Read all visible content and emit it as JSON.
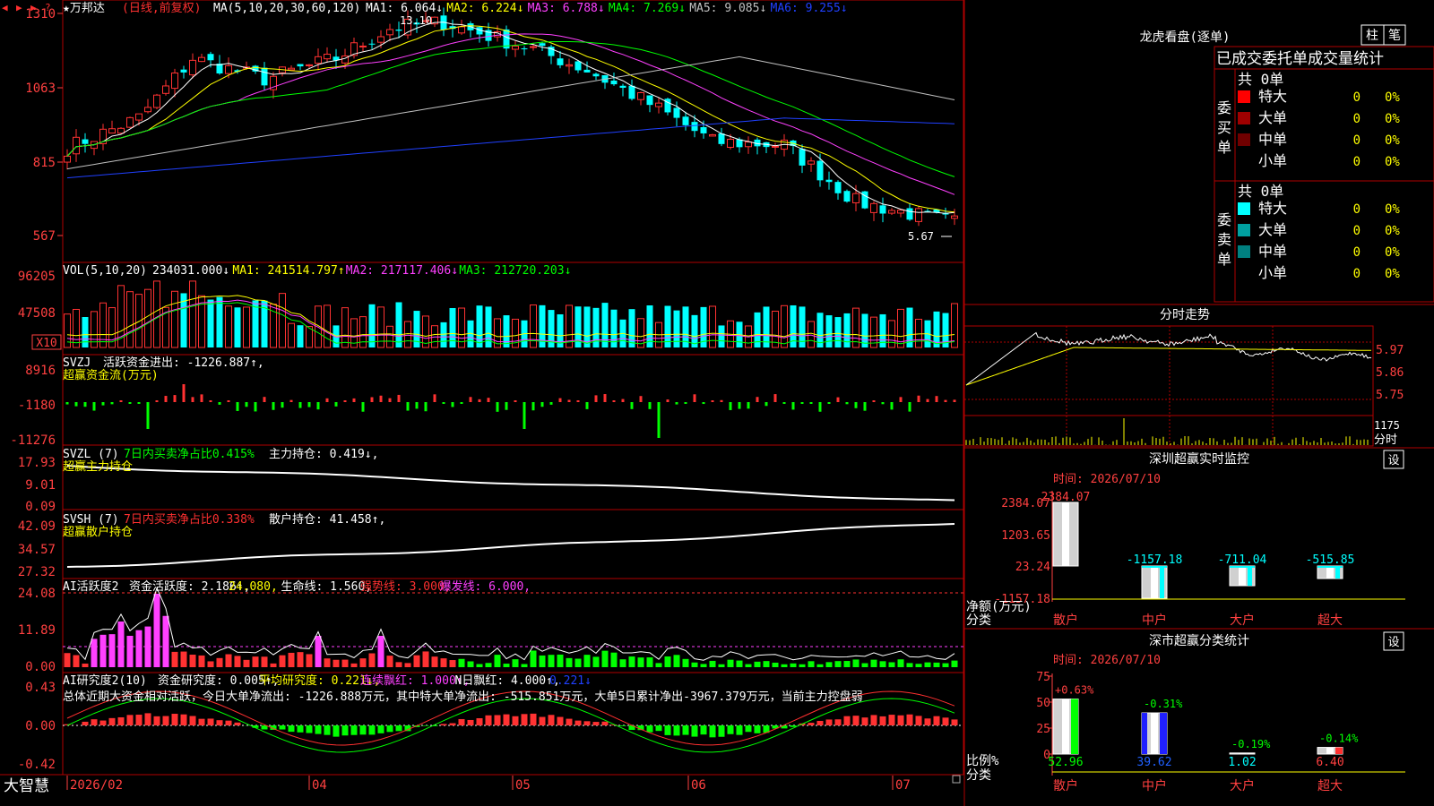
{
  "app": {
    "name": "大智慧"
  },
  "stock": {
    "title": "★万邦达",
    "mode": "(日线,前复权)",
    "title_color": "#ffffff",
    "mode_color": "#ff3030"
  },
  "top_icons": {
    "prev": "◀",
    "next": "▶",
    "refresh": "▶",
    "more": "?"
  },
  "price_axis": [
    "1310",
    "1063",
    "815",
    "567"
  ],
  "ma_header": {
    "label": "MA(5,10,20,30,60,120)",
    "items": [
      {
        "text": "MA1: 6.064↓",
        "color": "#ffffff"
      },
      {
        "text": "MA2: 6.224↓",
        "color": "#ffff00"
      },
      {
        "text": "MA3: 6.788↓",
        "color": "#ff40ff"
      },
      {
        "text": "MA4: 7.269↓",
        "color": "#00ff00"
      },
      {
        "text": "MA5: 9.085↓",
        "color": "#c0c0c0"
      },
      {
        "text": "MA6: 9.255↓",
        "color": "#2040ff"
      }
    ]
  },
  "price_marks": {
    "high": "13.10",
    "low": "5.67"
  },
  "vol_header": {
    "label": "VOL(5,10,20)",
    "items": [
      {
        "text": "234031.000↓",
        "color": "#ffffff"
      },
      {
        "text": "MA1: 241514.797↑",
        "color": "#ffff00"
      },
      {
        "text": "MA2: 217117.406↓",
        "color": "#ff40ff"
      },
      {
        "text": "MA3: 212720.203↓",
        "color": "#00ff00"
      }
    ]
  },
  "vol_axis": [
    "96205",
    "47508"
  ],
  "vol_unit": "X10",
  "svzj": {
    "label": "SVZJ",
    "active_text": "活跃资金进出: -1226.887↑,",
    "sub": "超赢资金流(万元)",
    "axis": [
      "8916",
      "-1180",
      "-11276"
    ]
  },
  "svzl": {
    "label": "SVZL (7)",
    "ratio_text": "7日内买卖净占比0.415%",
    "hold_text": "主力持仓: 0.419↓,",
    "sub": "超赢主力持仓",
    "axis": [
      "17.93",
      "9.01",
      "0.09"
    ]
  },
  "svsh": {
    "label": "SVSH (7)",
    "ratio_text": "7日内买卖净占比0.338%",
    "hold_text": "散户持仓: 41.458↑,",
    "sub": "超赢散户持仓",
    "axis": [
      "42.09",
      "34.57",
      "27.32"
    ]
  },
  "ai_active": {
    "label": "AI活跃度2",
    "items": [
      {
        "text": "资金活跃度: 2.186↑,",
        "color": "#ffffff"
      },
      {
        "text": "24.080,",
        "color": "#ffff00"
      },
      {
        "text": "生命线: 1.560,",
        "color": "#ffffff"
      },
      {
        "text": "强势线: 3.000,",
        "color": "#ff3030"
      },
      {
        "text": "爆发线: 6.000,",
        "color": "#ff40ff"
      }
    ],
    "axis": [
      "24.08",
      "11.89",
      "0.00"
    ]
  },
  "ai_research": {
    "label": "AI研究度2(10)",
    "items": [
      {
        "text": "资金研究度: 0.005↑,",
        "color": "#ffffff"
      },
      {
        "text": "平均研究度: 0.221↓,",
        "color": "#ffff00"
      },
      {
        "text": "连续飘红: 1.000↑,",
        "color": "#ff40ff"
      },
      {
        "text": "N日飘红: 4.000↑,",
        "color": "#ffffff"
      },
      {
        "text": "0.221↓",
        "color": "#2040ff"
      }
    ],
    "summary": "总体近期大资金相对活跃，今日大单净流出: -1226.888万元，其中特大单净流出: -515.851万元，大单5日累计净出-3967.379万元，当前主力控盘弱",
    "axis": [
      "0.43",
      "0.00",
      "-0.42"
    ]
  },
  "x_axis": {
    "labels": [
      "2026/02",
      "04",
      "05",
      "06",
      "07"
    ]
  },
  "dragon": {
    "title": "龙虎看盘(逐单)",
    "tab1": "柱",
    "tab2": "笔",
    "tabs_text": "已成交委托单成交量统计",
    "buy": {
      "side": [
        "委",
        "买",
        "单"
      ],
      "total": "共 0单",
      "rows": [
        {
          "name": "特大",
          "count": "0",
          "pct": "0%",
          "color": "#ff0000"
        },
        {
          "name": "大单",
          "count": "0",
          "pct": "0%",
          "color": "#a00000"
        },
        {
          "name": "中单",
          "count": "0",
          "pct": "0%",
          "color": "#700000"
        },
        {
          "name": "小单",
          "count": "0",
          "pct": "0%",
          "color": "#000000"
        }
      ]
    },
    "sell": {
      "side": [
        "委",
        "卖",
        "单"
      ],
      "total": "共 0单",
      "rows": [
        {
          "name": "特大",
          "count": "0",
          "pct": "0%",
          "color": "#00ffff"
        },
        {
          "name": "大单",
          "count": "0",
          "pct": "0%",
          "color": "#00a0a0"
        },
        {
          "name": "中单",
          "count": "0",
          "pct": "0%",
          "color": "#008080"
        },
        {
          "name": "小单",
          "count": "0",
          "pct": "0%",
          "color": "#000000"
        }
      ]
    }
  },
  "intraday": {
    "title": "分时走势",
    "price_axis": [
      "5.97",
      "5.86",
      "5.75"
    ],
    "vol_label": "1175",
    "vol_unit": "分时"
  },
  "sz_monitor": {
    "title": "深圳超赢实时监控",
    "set": "设",
    "time": "时间: 2026/07/10",
    "axis": [
      "2384.07",
      "1203.65",
      "23.24",
      "-1157.18"
    ],
    "ylabel": "净额(万元)",
    "xlabel": "分类",
    "categories": [
      "散户",
      "中户",
      "大户",
      "超大"
    ],
    "values": [
      2384.07,
      -1157.18,
      -711.04,
      -515.85
    ],
    "value_labels": [
      "2384.07",
      "-1157.18",
      "-711.04",
      "-515.85"
    ]
  },
  "sz_classify": {
    "title": "深市超赢分类统计",
    "set": "设",
    "time": "时间: 2026/07/10",
    "axis": [
      "75",
      "50",
      "25",
      "0"
    ],
    "ylabel": "比例%",
    "xlabel": "分类",
    "categories": [
      "散户",
      "中户",
      "大户",
      "超大"
    ],
    "values": [
      52.96,
      39.62,
      1.02,
      6.4
    ],
    "value_labels": [
      "52.96",
      "39.62",
      "1.02",
      "6.40"
    ],
    "change_labels": [
      "+0.63%",
      "-0.31%",
      "-0.19%",
      "-0.14%"
    ]
  },
  "colors": {
    "up": "#ff3232",
    "down": "#00ffff",
    "border": "#b00000",
    "axis_text": "#ff4040"
  }
}
